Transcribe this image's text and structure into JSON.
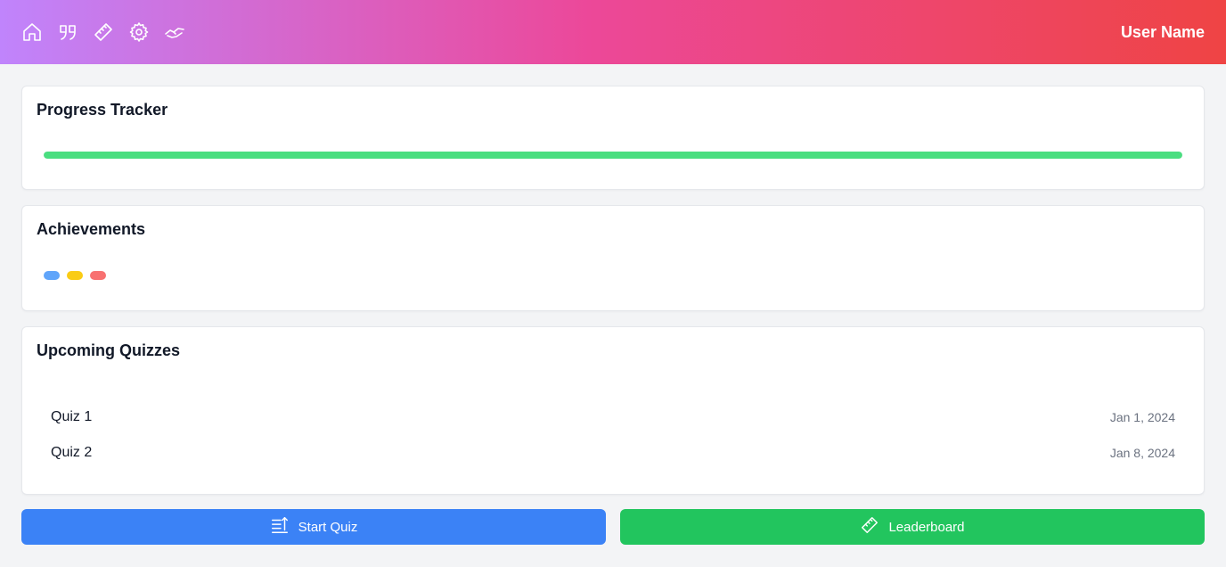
{
  "header": {
    "nav_icons": [
      "home-icon",
      "quote-icon",
      "ruler-icon",
      "gear-icon",
      "handshake-icon"
    ],
    "user_name": "User Name",
    "gradient_colors": [
      "#c084fc",
      "#ec4899",
      "#ef4444"
    ]
  },
  "progress": {
    "title": "Progress Tracker",
    "value_percent": 100,
    "bar_color": "#4ade80"
  },
  "achievements": {
    "title": "Achievements",
    "badge_colors": [
      "#60a5fa",
      "#facc15",
      "#f87171"
    ]
  },
  "quizzes": {
    "title": "Upcoming Quizzes",
    "items": [
      {
        "name": "Quiz 1",
        "date": "Jan 1, 2024"
      },
      {
        "name": "Quiz 2",
        "date": "Jan 8, 2024"
      }
    ]
  },
  "actions": {
    "start_quiz_label": "Start Quiz",
    "start_quiz_icon": "list-icon",
    "start_quiz_color": "#3b82f6",
    "leaderboard_label": "Leaderboard",
    "leaderboard_icon": "ruler-icon",
    "leaderboard_color": "#22c55e"
  }
}
